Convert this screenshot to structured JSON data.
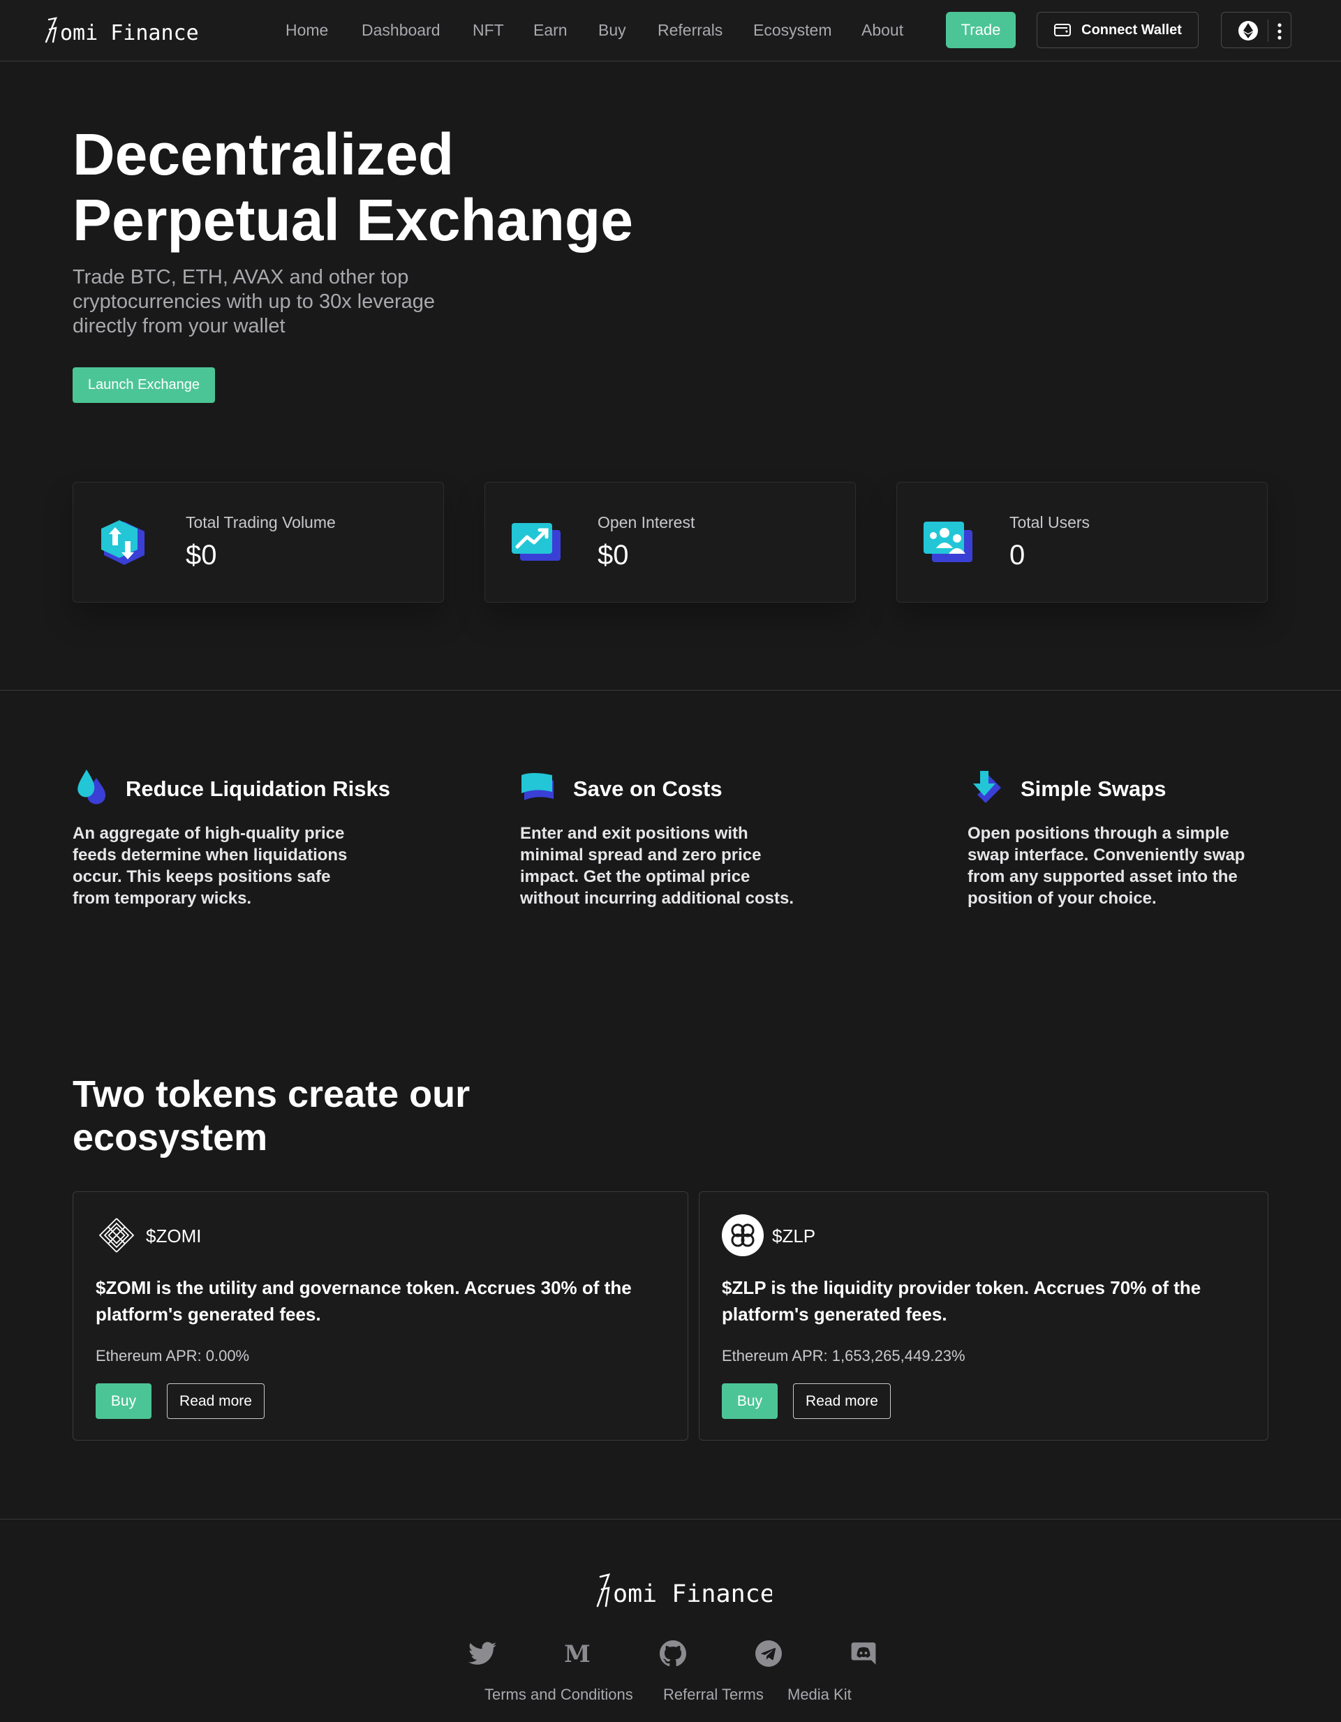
{
  "header": {
    "logo_text": "Zomi Finance",
    "nav": [
      "Home",
      "Dashboard",
      "NFT",
      "Earn",
      "Buy",
      "Referrals",
      "Ecosystem",
      "About"
    ],
    "trade_label": "Trade",
    "connect_label": "Connect Wallet",
    "network_icon": "ethereum-icon",
    "menu_icon": "more-vertical-icon"
  },
  "hero": {
    "title": "Decentralized Perpetual Exchange",
    "subtitle": "Trade BTC, ETH, AVAX and other top cryptocurrencies with up to 30x leverage directly from your wallet",
    "launch_label": "Launch Exchange"
  },
  "stats": [
    {
      "label": "Total Trading Volume",
      "value": "$0",
      "icon": "trading-volume-icon"
    },
    {
      "label": "Open Interest",
      "value": "$0",
      "icon": "open-interest-icon"
    },
    {
      "label": "Total Users",
      "value": "0",
      "icon": "users-icon"
    }
  ],
  "features": [
    {
      "title": "Reduce Liquidation Risks",
      "text": "An aggregate of high-quality price feeds determine when liquidations occur. This keeps positions safe from temporary wicks.",
      "icon": "liquidation-drop-icon"
    },
    {
      "title": "Save on Costs",
      "text": "Enter and exit positions with minimal spread and zero price impact. Get the optimal price without incurring additional costs.",
      "icon": "cost-wallet-icon"
    },
    {
      "title": "Simple Swaps",
      "text": "Open positions through a simple swap interface. Conveniently swap from any supported asset into the position of your choice.",
      "icon": "swap-arrow-icon"
    }
  ],
  "ecosystem": {
    "title": "Two tokens create our ecosystem",
    "tokens": [
      {
        "name": "$ZOMI",
        "desc": "$ZOMI is the utility and governance token. Accrues 30% of the platform's generated fees.",
        "apr": "Ethereum APR: 0.00%",
        "buy_label": "Buy",
        "more_label": "Read more",
        "icon": "zomi-knot-icon"
      },
      {
        "name": "$ZLP",
        "desc": "$ZLP is the liquidity provider token. Accrues 70% of the platform's generated fees.",
        "apr": "Ethereum APR: 1,653,265,449.23%",
        "buy_label": "Buy",
        "more_label": "Read more",
        "icon": "zlp-clover-icon"
      }
    ]
  },
  "footer": {
    "logo_text": "Zomi Finance",
    "social": [
      "twitter-icon",
      "medium-icon",
      "github-icon",
      "telegram-icon",
      "discord-icon"
    ],
    "links": [
      "Terms and Conditions",
      "Referral Terms",
      "Media Kit"
    ]
  },
  "colors": {
    "background": "#19191a",
    "accent": "#4cc596",
    "muted_text": "#a9a9ae",
    "border": "#3a3a3d"
  }
}
